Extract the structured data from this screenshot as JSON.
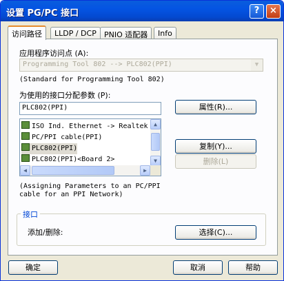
{
  "window": {
    "title": "设置 PG/PC 接口",
    "help_icon": "?",
    "close_icon": "×"
  },
  "tabs": [
    {
      "label": "访问路径"
    },
    {
      "label": "LLDP / DCP"
    },
    {
      "label": "PNIO 适配器"
    },
    {
      "label": "Info"
    }
  ],
  "access_point": {
    "label": "应用程序访问点 (A):",
    "value": "Programming Tool 802        --> PLC802(PPI)",
    "description": "(Standard for Programming Tool 802)"
  },
  "interface_param": {
    "label": "为使用的接口分配参数 (P):",
    "value": "PLC802(PPI)",
    "items": [
      {
        "label": "ISO Ind. Ethernet -> Realtek"
      },
      {
        "label": "PC/PPI cable(PPI)"
      },
      {
        "label": "PLC802(PPI)"
      },
      {
        "label": "PLC802(PPI)<Board 2>"
      }
    ],
    "description": "(Assigning Parameters to an PC/PPI cable for an PPI Network)"
  },
  "buttons": {
    "properties": "属性(R)...",
    "copy": "复制(Y)...",
    "delete": "删除(L)",
    "select": "选择(C)...",
    "ok": "确定",
    "cancel": "取消",
    "help": "帮助"
  },
  "interface_group": {
    "title": "接口",
    "add_remove_label": "添加/删除:"
  },
  "scroll_icons": {
    "up": "▲",
    "down": "▼",
    "left": "◀",
    "right": "▶",
    "combo": "▼"
  },
  "colors": {
    "titlebar": "#0454e3",
    "dialog_bg": "#ece9d8",
    "tab_accent": "#e68b2c",
    "group_title": "#0046d5"
  }
}
